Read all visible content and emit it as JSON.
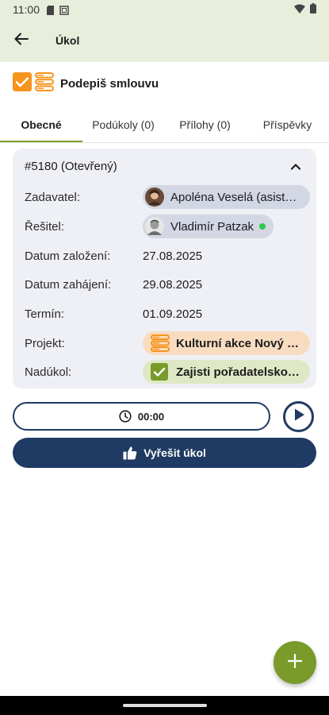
{
  "status_bar": {
    "time": "11:00",
    "icons": [
      "sim-card-icon",
      "screenshot-icon",
      "wifi-icon",
      "battery-icon"
    ]
  },
  "app_bar": {
    "title": "Úkol",
    "back_icon": "arrow-left-icon"
  },
  "task": {
    "title": "Podepiš smlouvu",
    "checkbox_checked": true,
    "accent_color": "#f7941d"
  },
  "tabs": [
    {
      "label": "Obecné",
      "active": true
    },
    {
      "label": "Podúkoly (0)",
      "active": false
    },
    {
      "label": "Přílohy (0)",
      "active": false
    },
    {
      "label": "Příspěvky",
      "active": false
    }
  ],
  "details": {
    "header": "#5180 (Otevřený)",
    "collapse_icon": "chevron-up-icon",
    "assigner": {
      "label": "Zadavatel:",
      "name": "Apoléna Veselá (asistentka)"
    },
    "assignee": {
      "label": "Řešitel:",
      "name": "Vladimír Patzak",
      "online": true
    },
    "created": {
      "label": "Datum založení:",
      "value": "27.08.2025"
    },
    "started": {
      "label": "Datum zahájení:",
      "value": "29.08.2025"
    },
    "deadline": {
      "label": "Termín:",
      "value": "01.09.2025"
    },
    "project": {
      "label": "Projekt:",
      "name": "Kulturní akce Nový rok"
    },
    "parent_task": {
      "label": "Nadúkol:",
      "name": "Zajisti pořadatelskou službu"
    }
  },
  "timer": {
    "value": "00:00",
    "icon": "clock-icon",
    "play_icon": "play-icon"
  },
  "resolve_button": {
    "label": "Vyřešit úkol",
    "icon": "thumbs-up-icon"
  },
  "fab": {
    "icon": "plus-icon"
  },
  "colors": {
    "header_bg": "#e8eedc",
    "primary_dark": "#1f3a63",
    "green_accent": "#7a9a2a",
    "orange_accent": "#f7941d",
    "card_bg": "#eff0f5"
  }
}
